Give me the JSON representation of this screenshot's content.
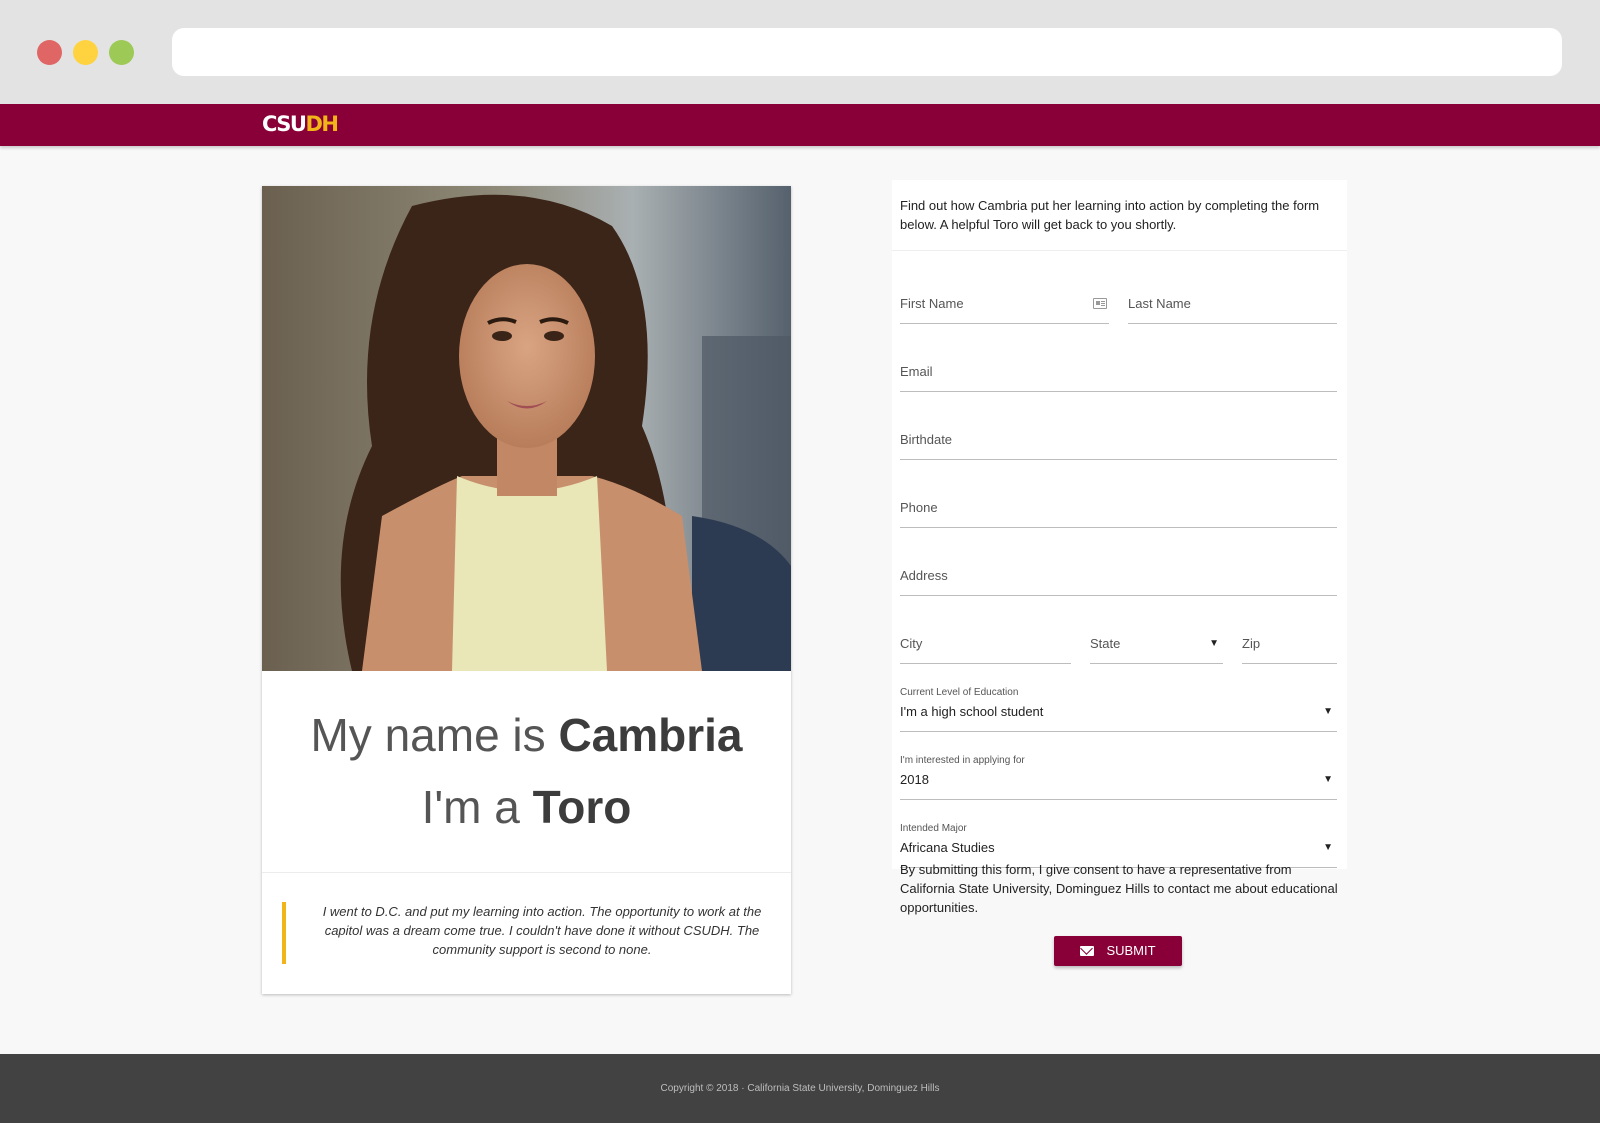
{
  "brand": {
    "logo_part1": "CSU",
    "logo_part2": "DH",
    "primary_color": "#880037",
    "accent_color": "#f2b519"
  },
  "profile": {
    "photo_alt": "Portrait of Cambria",
    "line1_light": "My name is ",
    "line1_bold": "Cambria",
    "line2_light": "I'm a ",
    "line2_bold": "Toro",
    "quote": "I went to D.C. and put my learning into action. The opportunity to work at the capitol was a dream come true. I couldn't have done it without CSUDH. The community support is second to none."
  },
  "form": {
    "intro": "Find out how Cambria put her learning into action by completing the form below. A helpful Toro will get back to you shortly.",
    "first_name_label": "First Name",
    "last_name_label": "Last Name",
    "email_label": "Email",
    "birthdate_label": "Birthdate",
    "phone_label": "Phone",
    "address_label": "Address",
    "city_label": "City",
    "state_label": "State",
    "zip_label": "Zip",
    "education_label": "Current Level of Education",
    "education_value": "I'm a high school student",
    "applying_label": "I'm interested in applying for",
    "applying_value": "2018",
    "major_label": "Intended Major",
    "major_value": "Africana Studies",
    "consent": "By submitting this form, I give consent to have a representative from California State University, Dominguez Hills to contact me about educational opportunities.",
    "submit_label": "SUBMIT",
    "caret": "▼"
  },
  "footer": {
    "copyright": "Copyright © 2018 · California State University, Dominguez Hills"
  }
}
